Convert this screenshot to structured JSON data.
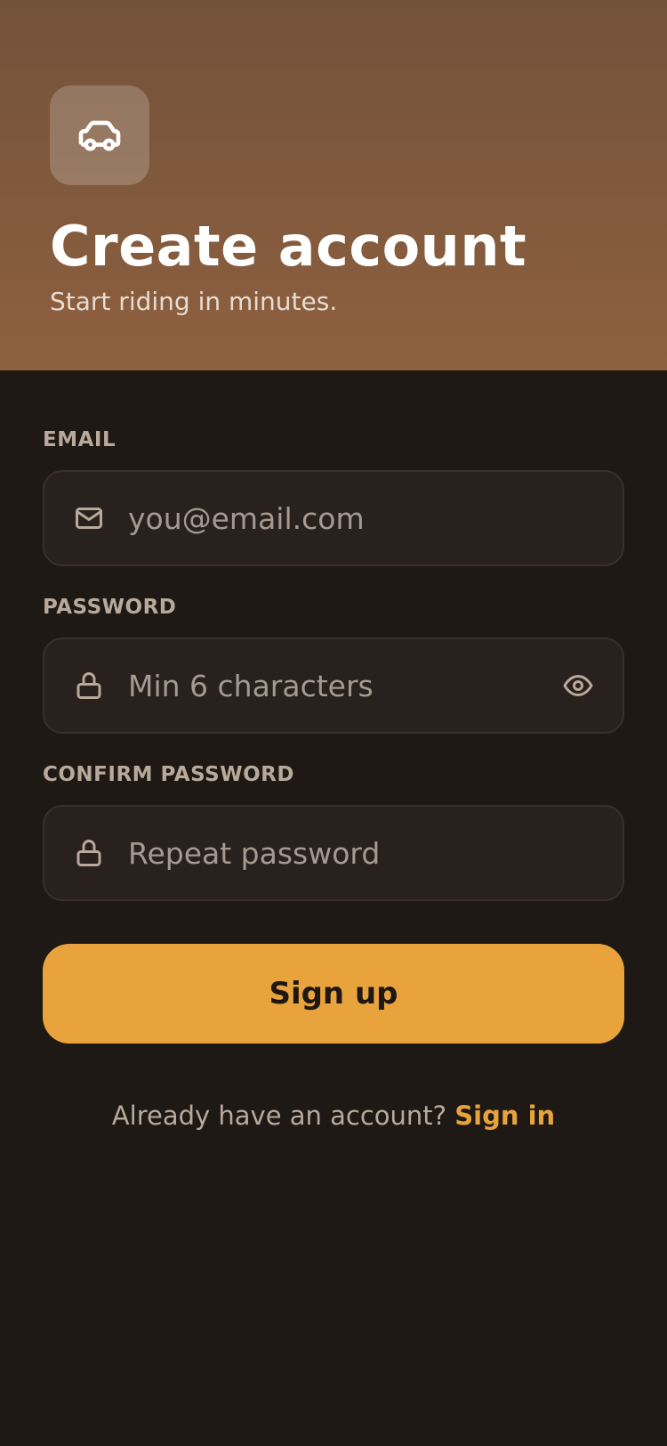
{
  "header": {
    "app_icon": "car-icon",
    "title": "Create account",
    "subtitle": "Start riding in minutes."
  },
  "form": {
    "email": {
      "label": "EMAIL",
      "icon": "mail-icon",
      "value": "",
      "placeholder": "you@email.com"
    },
    "password": {
      "label": "PASSWORD",
      "icon": "lock-icon",
      "value": "",
      "placeholder": "Min 6 characters",
      "toggle_icon": "eye-icon"
    },
    "confirm_password": {
      "label": "CONFIRM PASSWORD",
      "icon": "lock-icon",
      "value": "",
      "placeholder": "Repeat password"
    },
    "submit_label": "Sign up"
  },
  "footer": {
    "prompt": "Already have an account?",
    "link_label": "Sign in"
  },
  "colors": {
    "header_top": "#73523a",
    "header_bottom": "#8e603f",
    "background": "#1e1915",
    "field_bg": "#29211d",
    "accent": "#e8a33d"
  }
}
